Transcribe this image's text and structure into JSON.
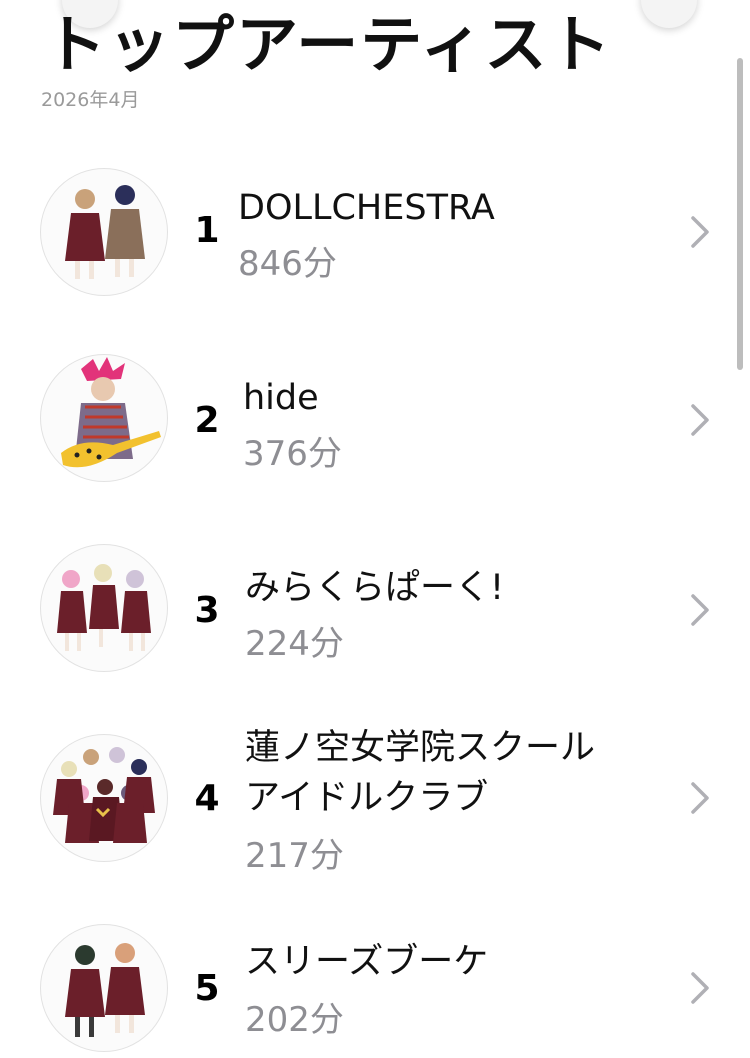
{
  "header": {
    "title": "トップアーティスト",
    "period": "2026年4月"
  },
  "artists": [
    {
      "rank": "1",
      "name": "DOLLCHESTRA",
      "minutes": "846分",
      "avatar_icon": "duo-schoolgirls-avatar-icon"
    },
    {
      "rank": "2",
      "name": "hide",
      "minutes": "376分",
      "avatar_icon": "guitarist-avatar-icon"
    },
    {
      "rank": "3",
      "name": "みらくらぱーく!",
      "minutes": "224分",
      "avatar_icon": "trio-schoolgirls-avatar-icon"
    },
    {
      "rank": "4",
      "name_line1": "蓮ノ空女学院スクール",
      "name_line2": "アイドルクラブ",
      "minutes": "217分",
      "avatar_icon": "group-schoolgirls-avatar-icon"
    },
    {
      "rank": "5",
      "name": "スリーズブーケ",
      "minutes": "202分",
      "avatar_icon": "duo-schoolgirls-avatar-icon"
    }
  ],
  "colors": {
    "secondary_text": "#8e8e93",
    "chevron": "#b0b0b5",
    "uniform": "#6b1f2a",
    "period_text": "#9a9a9a"
  }
}
